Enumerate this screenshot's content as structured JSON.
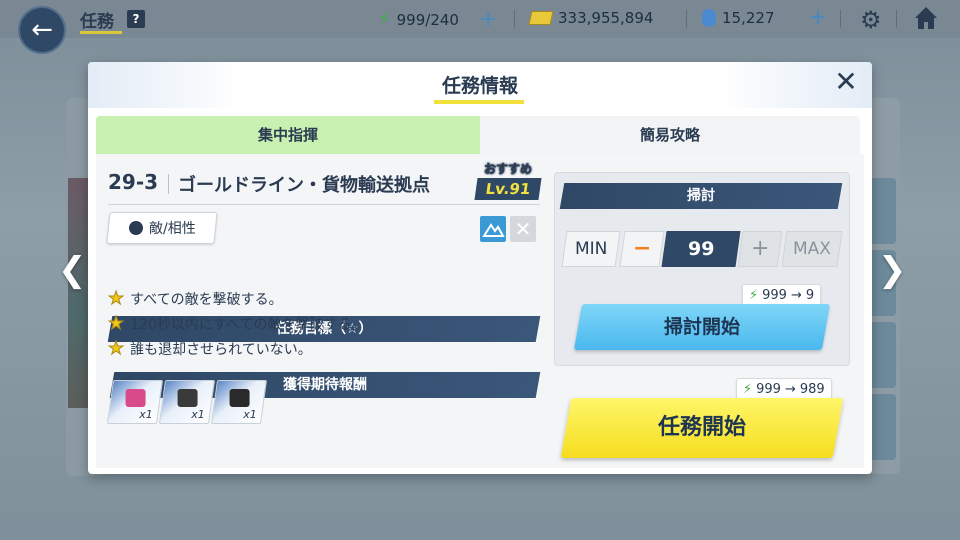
{
  "topbar": {
    "title": "任務",
    "help": "?",
    "ap": "999/240",
    "credits": "333,955,894",
    "pyroxene": "15,227"
  },
  "modal": {
    "title": "任務情報",
    "tabs": [
      "集中指揮",
      "簡易攻略"
    ],
    "mission_id": "29-3",
    "mission_name": "ゴールドライン・貨物輸送拠点",
    "recommended_label": "おすすめ",
    "recommended_level": "Lv.91",
    "enemy_button": "敵/相性",
    "goals_header": "任務目標（☆）",
    "goals": [
      "すべての敵を撃破する。",
      "120秒以内にすべての敵を撃破する。",
      "誰も退却させられていない。"
    ],
    "rewards_header": "獲得期待報酬",
    "rewards": [
      {
        "qty": "x1",
        "color": "#d84a8a"
      },
      {
        "qty": "x1",
        "color": "#3a3a3a"
      },
      {
        "qty": "x1",
        "color": "#2a2a2a"
      }
    ],
    "sweep": {
      "header": "掃討",
      "min_label": "MIN",
      "minus": "−",
      "count": "99",
      "plus": "+",
      "max_label": "MAX",
      "cost_from": "999",
      "cost_to": "9",
      "start_label": "掃討開始"
    },
    "start": {
      "cost_from": "999",
      "cost_to": "989",
      "label": "任務開始"
    }
  },
  "colors": {
    "accent_navy": "#2f4866",
    "tab_active": "#c8f0b0",
    "sweep_button": "#4ab8ee",
    "start_button": "#f5dd1e",
    "ap_bolt": "#3db04a"
  }
}
